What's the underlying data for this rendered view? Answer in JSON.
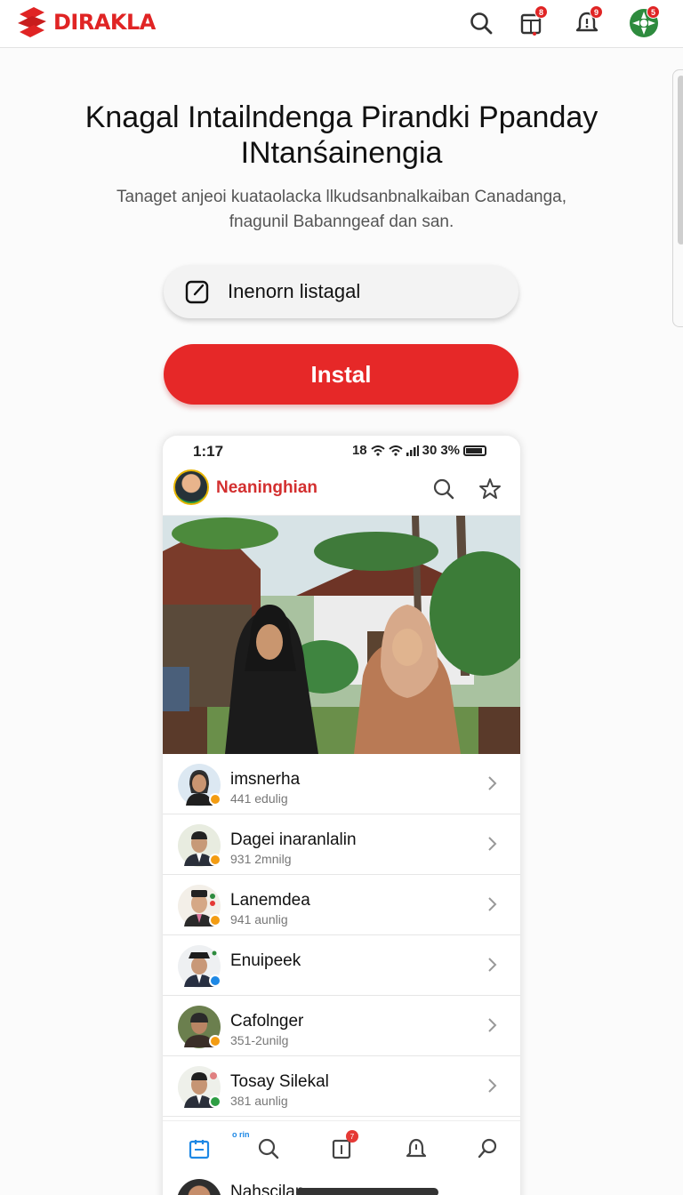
{
  "brand": {
    "name": "DIRAKLA",
    "color": "#e02424"
  },
  "topbar": {
    "icons": [
      {
        "name": "search-icon"
      },
      {
        "name": "calendar-icon",
        "badge": "8"
      },
      {
        "name": "bell-icon",
        "badge": "9"
      },
      {
        "name": "profile-icon",
        "badge": "5"
      }
    ]
  },
  "hero": {
    "title_line1": "Knagal Intailndenga Pirandki Ppanday",
    "title_line2": "INtanśainengia",
    "subtitle_line1": "Tanaget anjeoi kuataolacka llkudsanbnalkaiban Canadanga,",
    "subtitle_line2": "fnagunil Babanngeaf dan san.",
    "search_value": "Inenorn listagal",
    "install_label": "Instal"
  },
  "phone": {
    "status_time": "1:17",
    "status_right": "18",
    "status_net": "30",
    "status_battery": "3%",
    "app_name": "Neaninghian",
    "list": [
      {
        "name": "imsnerha",
        "meta": "441 edulig",
        "dot": "#f39c12"
      },
      {
        "name": "Dagei inaranlalin",
        "meta": "931 2mnilg",
        "dot": "#f39c12"
      },
      {
        "name": "Lanemdea",
        "meta": "941 aunlig",
        "dot": "#f39c12"
      },
      {
        "name": "Enuipeek",
        "meta": "",
        "dot": "#1e88e5"
      },
      {
        "name": "Cafolnger",
        "meta": "351-2unilg",
        "dot": "#f39c12"
      },
      {
        "name": "Tosay Silekal",
        "meta": "381 aunlig",
        "dot": "#2e9e44"
      }
    ],
    "nav": {
      "small_label": "o rin",
      "badge": "7"
    },
    "peek_name": "Nahscilan"
  },
  "colors": {
    "accent": "#e62828",
    "link_blue": "#1e88e5"
  }
}
